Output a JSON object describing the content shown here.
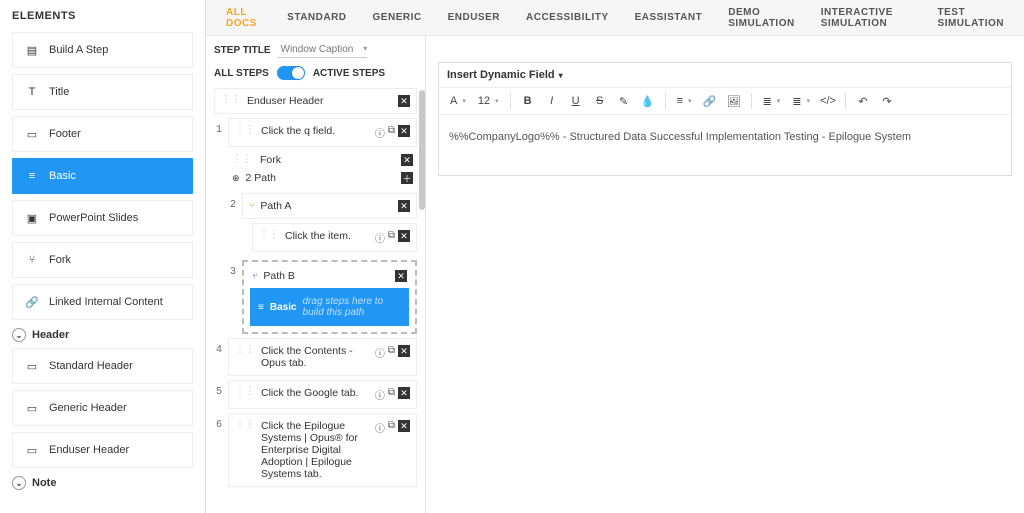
{
  "left": {
    "title": "ELEMENTS",
    "items": [
      {
        "label": "Build A Step",
        "icon": "stairs-icon"
      },
      {
        "label": "Title",
        "icon": "t-icon"
      },
      {
        "label": "Footer",
        "icon": "footer-icon"
      },
      {
        "label": "Basic",
        "icon": "basic-icon",
        "active": true
      },
      {
        "label": "PowerPoint Slides",
        "icon": "ppt-icon"
      },
      {
        "label": "Fork",
        "icon": "fork-icon"
      },
      {
        "label": "Linked Internal Content",
        "icon": "link-icon"
      }
    ],
    "section_header": "Header",
    "headers": [
      {
        "label": "Standard Header"
      },
      {
        "label": "Generic Header"
      },
      {
        "label": "Enduser Header"
      }
    ],
    "section_note": "Note"
  },
  "tabs": [
    {
      "label": "ALL DOCS",
      "active": true
    },
    {
      "label": "STANDARD"
    },
    {
      "label": "GENERIC"
    },
    {
      "label": "ENDUSER"
    },
    {
      "label": "ACCESSIBILITY"
    },
    {
      "label": "EASSISTANT"
    },
    {
      "label": "DEMO SIMULATION"
    },
    {
      "label": "INTERACTIVE SIMULATION"
    },
    {
      "label": "TEST SIMULATION"
    }
  ],
  "mid": {
    "step_title_label": "STEP TITLE",
    "step_title_value": "Window Caption",
    "all_steps": "ALL STEPS",
    "active_steps": "ACTIVE STEPS",
    "header_step": "Enduser Header",
    "step1": "Click the q field.",
    "fork_label": "Fork",
    "path_count": "2 Path",
    "path_a": "Path A",
    "path_a_step": "Click the item.",
    "path_b": "Path B",
    "drop_hint": "drag steps here to build this path",
    "drop_label": "Basic",
    "step4": "Click the Contents - Opus tab.",
    "step5": "Click the Google tab.",
    "step6": "Click the Epilogue Systems | Opus® for Enterprise Digital Adoption | Epilogue Systems tab.",
    "n1": "1",
    "n2": "2",
    "n3": "3",
    "n4": "4",
    "n5": "5",
    "n6": "6"
  },
  "editor": {
    "insert_dynamic": "Insert Dynamic Field",
    "font_family": "A",
    "font_size": "12",
    "content": "%%CompanyLogo%% - Structured Data Successful Implementation Testing - Epilogue System"
  }
}
